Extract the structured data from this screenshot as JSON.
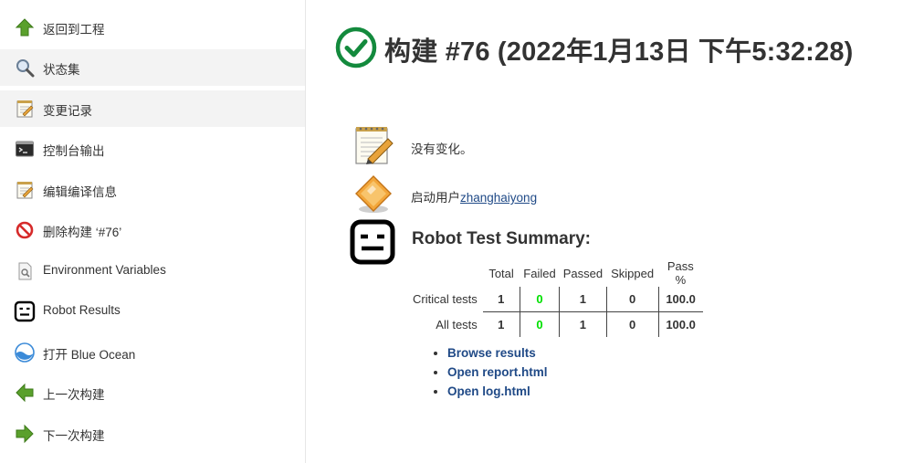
{
  "sidebar": {
    "items": [
      {
        "label": "返回到工程",
        "icon": "up-arrow-icon"
      },
      {
        "label": "状态集",
        "icon": "magnifier-icon"
      },
      {
        "label": "变更记录",
        "icon": "notepad-icon"
      },
      {
        "label": "控制台输出",
        "icon": "terminal-icon"
      },
      {
        "label": "编辑编译信息",
        "icon": "notepad-icon"
      },
      {
        "label": "删除构建 ‘#76’",
        "icon": "no-entry-icon"
      },
      {
        "label": "Environment Variables",
        "icon": "document-search-icon"
      },
      {
        "label": "Robot Results",
        "icon": "robot-icon"
      },
      {
        "label": "打开 Blue Ocean",
        "icon": "blue-ocean-icon"
      },
      {
        "label": "上一次构建",
        "icon": "left-arrow-icon"
      },
      {
        "label": "下一次构建",
        "icon": "right-arrow-icon"
      }
    ]
  },
  "build": {
    "title": "构建 #76 (2022年1月13日 下午5:32:28)",
    "status_icon": "success-check-icon",
    "changes_text": "没有变化。",
    "started_by_prefix": "启动用户",
    "started_by_user": "zhanghaiyong"
  },
  "robot": {
    "heading": "Robot Test Summary:",
    "columns": [
      "Total",
      "Failed",
      "Passed",
      "Skipped",
      "Pass %"
    ],
    "rows": [
      {
        "label": "Critical tests",
        "total": "1",
        "failed": "0",
        "passed": "1",
        "skipped": "0",
        "pass_pct": "100.0"
      },
      {
        "label": "All tests",
        "total": "1",
        "failed": "0",
        "passed": "1",
        "skipped": "0",
        "pass_pct": "100.0"
      }
    ],
    "links": [
      "Browse results",
      "Open report.html",
      "Open log.html"
    ]
  },
  "colors": {
    "success": "#138a3d",
    "link": "#204a87",
    "failed_zero": "#00e000",
    "highlight": "#f3f3f3"
  }
}
